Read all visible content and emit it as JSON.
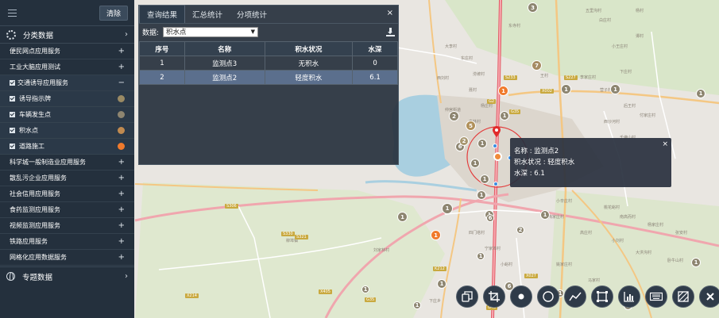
{
  "sidebar": {
    "clear_label": "清除",
    "category_title": "分类数据",
    "items": [
      {
        "label": "便民网点应用服务",
        "sign": "+"
      },
      {
        "label": "工业大脑应用测试",
        "sign": "+"
      },
      {
        "label": "交通诱导应用服务",
        "sign": "−"
      }
    ],
    "subitems": [
      {
        "label": "诱导指示牌",
        "color": "#9a8a64"
      },
      {
        "label": "车辆发生点",
        "color": "#8e8570"
      },
      {
        "label": "积水点",
        "color": "#c08a50"
      },
      {
        "label": "道路施工",
        "color": "#f07a2c"
      }
    ],
    "items2": [
      {
        "label": "科学城一般制造业应用服务",
        "sign": "+"
      },
      {
        "label": "散乱污企业应用服务",
        "sign": "+"
      },
      {
        "label": "社会信用应用服务",
        "sign": "+"
      },
      {
        "label": "食药监测应用服务",
        "sign": "+"
      },
      {
        "label": "视频监测应用服务",
        "sign": "+"
      },
      {
        "label": "铁路应用服务",
        "sign": "+"
      },
      {
        "label": "网格化应用数据服务",
        "sign": "+"
      }
    ],
    "special_title": "专题数据"
  },
  "panel": {
    "tabs": [
      "查询结果",
      "汇总统计",
      "分项统计"
    ],
    "data_label": "数据:",
    "dataset": "积水点",
    "columns": [
      "序号",
      "名称",
      "积水状况",
      "水深"
    ],
    "rows": [
      [
        "1",
        "监测点3",
        "无积水",
        "0"
      ],
      [
        "2",
        "监测点2",
        "轻度积水",
        "6.1"
      ]
    ]
  },
  "popup": {
    "name_line": "名称 : 监测点2",
    "status_line": "积水状况 : 轻度积水",
    "depth_line": "水深 : 6.1"
  },
  "map_labels": [
    "五里沟村",
    "白庄村",
    "东寺村",
    "杨村",
    "小王庄村",
    "下庄村",
    "谭村",
    "大李村",
    "东庄村",
    "涝坡村",
    "西刘村",
    "聂村",
    "杨庄村",
    "仲宫街道",
    "枣林村",
    "王村",
    "李家庄村",
    "营子村",
    "后王村",
    "付家庄村",
    "西沙河村",
    "千佛山村",
    "小辛庄村",
    "桃花峪村",
    "南高而村",
    "杨家庄村",
    "张安村",
    "陶家庄村",
    "高庄村",
    "小刘村",
    "大洪沟村",
    "卧牛山村",
    "四门塔村",
    "宁家埠村",
    "小峪村",
    "姚家庄村",
    "马家村",
    "柳埠镇",
    "刘家林村",
    "下庄乡"
  ],
  "road_signs": [
    "S233",
    "G2",
    "G35",
    "S227",
    "X002",
    "S306",
    "S330",
    "S321",
    "K212",
    "X405",
    "G35",
    "X214",
    "X027",
    "G45"
  ],
  "markers": [
    "3",
    "1",
    "1",
    "1",
    "1",
    "2",
    "5",
    "6",
    "2",
    "1",
    "1",
    "1",
    "1",
    "7",
    "1",
    "1",
    "1",
    "1",
    "1",
    "6",
    "1",
    "1",
    "1",
    "1",
    "2",
    "1",
    "6",
    "1",
    "1",
    "1"
  ],
  "toolbar": [
    "copy-icon",
    "crop-icon",
    "point-icon",
    "circle-icon",
    "polyline-icon",
    "rectangle-icon",
    "chart-icon",
    "keyboard-icon",
    "hatch-icon",
    "close-icon"
  ]
}
